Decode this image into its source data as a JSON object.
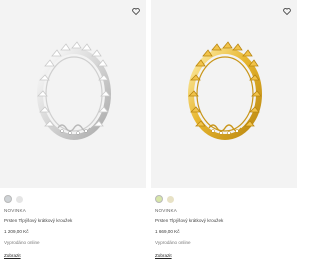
{
  "products": [
    {
      "badge": "NOVINKA",
      "name": "Prsten Tlpýšový krátkový kroužek",
      "price": "1 209,00 Kč",
      "availability": "Vyprodáno online",
      "cta_label": "Zobrazit",
      "metal": "silver",
      "metal_color": "#d9d9d9",
      "swatches": [
        "#cfd3d6",
        "#e5e5e5"
      ]
    },
    {
      "badge": "NOVINKA",
      "name": "Prsten Tlpýšový krátkový kroužek",
      "price": "1 669,00 Kč",
      "availability": "Vyprodáno online",
      "cta_label": "Zobrazit",
      "metal": "gold",
      "metal_color": "#e0b12e",
      "swatches": [
        "#d7e6a9",
        "#e8e2c6"
      ]
    }
  ],
  "icons": {
    "wishlist": "heart-outline-icon"
  }
}
